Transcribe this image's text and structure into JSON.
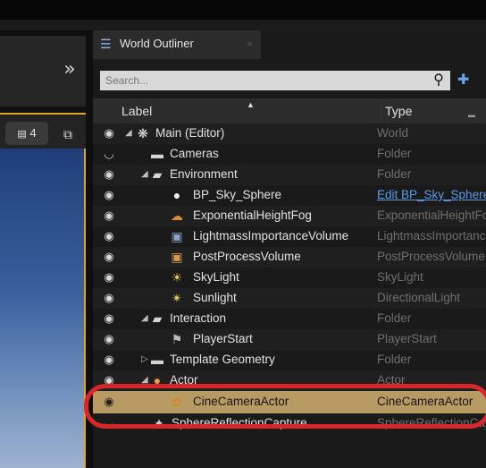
{
  "left_panel": {
    "expand_label": "»",
    "viewport_badge": "4",
    "maximize_label": "⧉"
  },
  "outliner": {
    "tab_title": "World Outliner",
    "tab_close": "×",
    "search_placeholder": "Search...",
    "columns": {
      "label": "Label",
      "type": "Type"
    },
    "rows": [
      {
        "label": "Main (Editor)",
        "type": "World",
        "icon": "world-icon",
        "arrow": "◢"
      },
      {
        "label": "Cameras",
        "type": "Folder",
        "icon": "folder-icon",
        "arrow": ""
      },
      {
        "label": "Environment",
        "type": "Folder",
        "icon": "folder-open-icon",
        "arrow": "◢"
      },
      {
        "label": "BP_Sky_Sphere",
        "type": "Edit BP_Sky_Sphere",
        "icon": "sphere-icon",
        "arrow": ""
      },
      {
        "label": "ExponentialHeightFog",
        "type": "ExponentialHeightFog",
        "icon": "fog-icon",
        "arrow": ""
      },
      {
        "label": "LightmassImportanceVolume",
        "type": "LightmassImportanceVolume",
        "icon": "volume-icon",
        "arrow": ""
      },
      {
        "label": "PostProcessVolume",
        "type": "PostProcessVolume",
        "icon": "volume-icon",
        "arrow": ""
      },
      {
        "label": "SkyLight",
        "type": "SkyLight",
        "icon": "skylight-icon",
        "arrow": ""
      },
      {
        "label": "Sunlight",
        "type": "DirectionalLight",
        "icon": "sun-icon",
        "arrow": ""
      },
      {
        "label": "Interaction",
        "type": "Folder",
        "icon": "folder-open-icon",
        "arrow": "◢"
      },
      {
        "label": "PlayerStart",
        "type": "PlayerStart",
        "icon": "player-start-icon",
        "arrow": ""
      },
      {
        "label": "Template Geometry",
        "type": "Folder",
        "icon": "folder-icon",
        "arrow": "▷"
      },
      {
        "label": "Actor",
        "type": "Actor",
        "icon": "actor-icon",
        "arrow": "◢"
      },
      {
        "label": "CineCameraActor",
        "type": "CineCameraActor",
        "icon": "camera-icon",
        "arrow": ""
      },
      {
        "label": "SphereReflectionCapture",
        "type": "SphereReflectionCapture",
        "icon": "reflection-icon",
        "arrow": ""
      }
    ]
  },
  "colors": {
    "selection": "#b89a63",
    "highlight_ring": "#d8262b",
    "link": "#5b9de6",
    "viewport_border": "#d8a52a"
  }
}
